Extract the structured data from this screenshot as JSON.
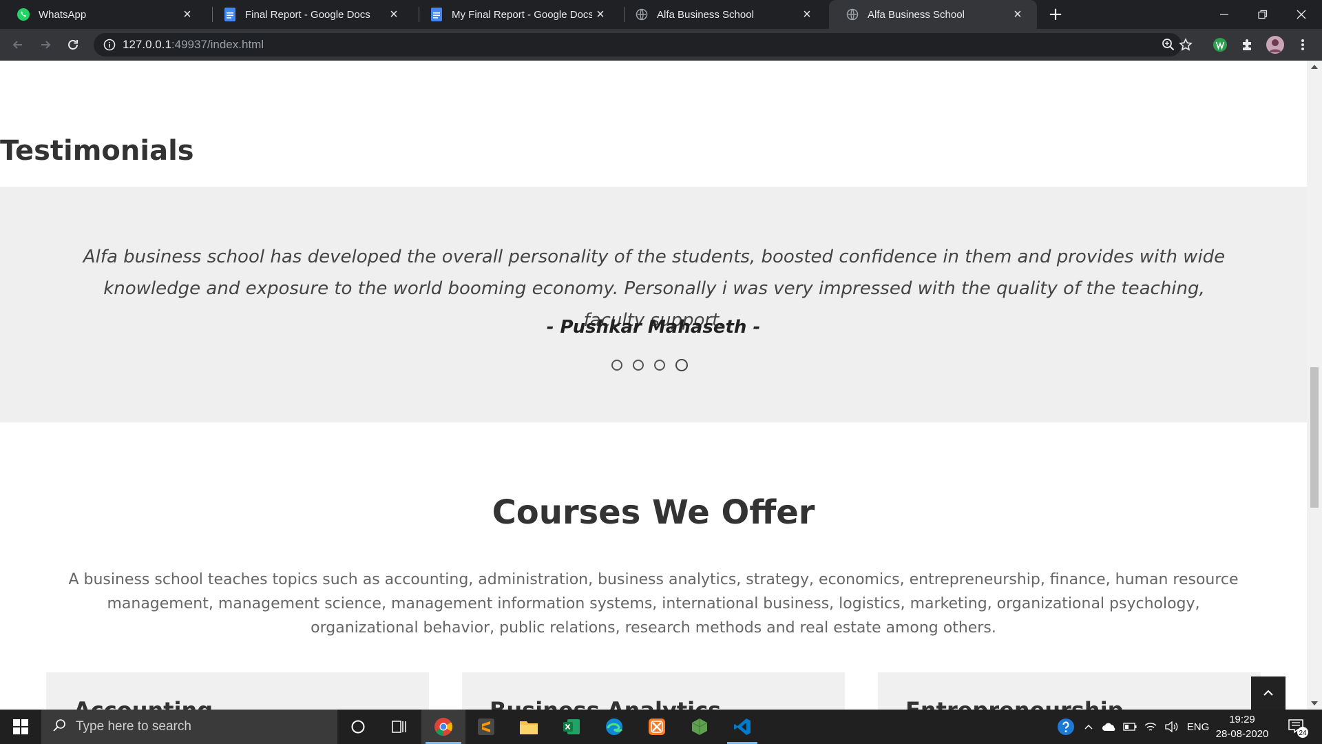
{
  "browser": {
    "tabs": [
      {
        "title": "WhatsApp",
        "icon": "whatsapp-icon",
        "active": false
      },
      {
        "title": "Final Report - Google Docs",
        "icon": "google-docs-icon",
        "active": false
      },
      {
        "title": "My Final Report - Google Docs",
        "icon": "google-docs-icon",
        "active": false
      },
      {
        "title": "Alfa Business School",
        "icon": "globe-icon",
        "active": false
      },
      {
        "title": "Alfa Business School",
        "icon": "globe-icon",
        "active": true
      }
    ],
    "url_host": "127.0.0.1",
    "url_rest": ":49937/index.html"
  },
  "page": {
    "testimonials_heading": "Testimonials",
    "testimonial": {
      "quote": "Alfa business school has developed the overall personality of the students, boosted confidence in them and provides with wide knowledge and exposure to the world booming economy. Personally i was very impressed with the quality of the teaching, faculty support.",
      "author": "- Pushkar Mahaseth -",
      "slide_count": 4,
      "active_slide": 4
    },
    "courses_heading": "Courses We Offer",
    "courses_description": "A business school teaches topics such as accounting, administration, business analytics, strategy, economics, entrepreneurship, finance, human resource management, management science, management information systems, international business, logistics, marketing, organizational psychology, organizational behavior, public relations, research methods and real estate among others.",
    "course_cards": [
      "Accounting",
      "Business Analytics",
      "Entrepreneurship"
    ]
  },
  "taskbar": {
    "search_placeholder": "Type here to search",
    "language": "ENG",
    "time": "19:29",
    "date": "28-08-2020",
    "notification_count": "24"
  },
  "colors": {
    "chrome_dark": "#202124",
    "chrome_toolbar": "#35363a",
    "testimonial_band": "#efefef",
    "heading_text": "#333333",
    "taskbar": "#202020",
    "taskbar_accent": "#76b9ed"
  }
}
